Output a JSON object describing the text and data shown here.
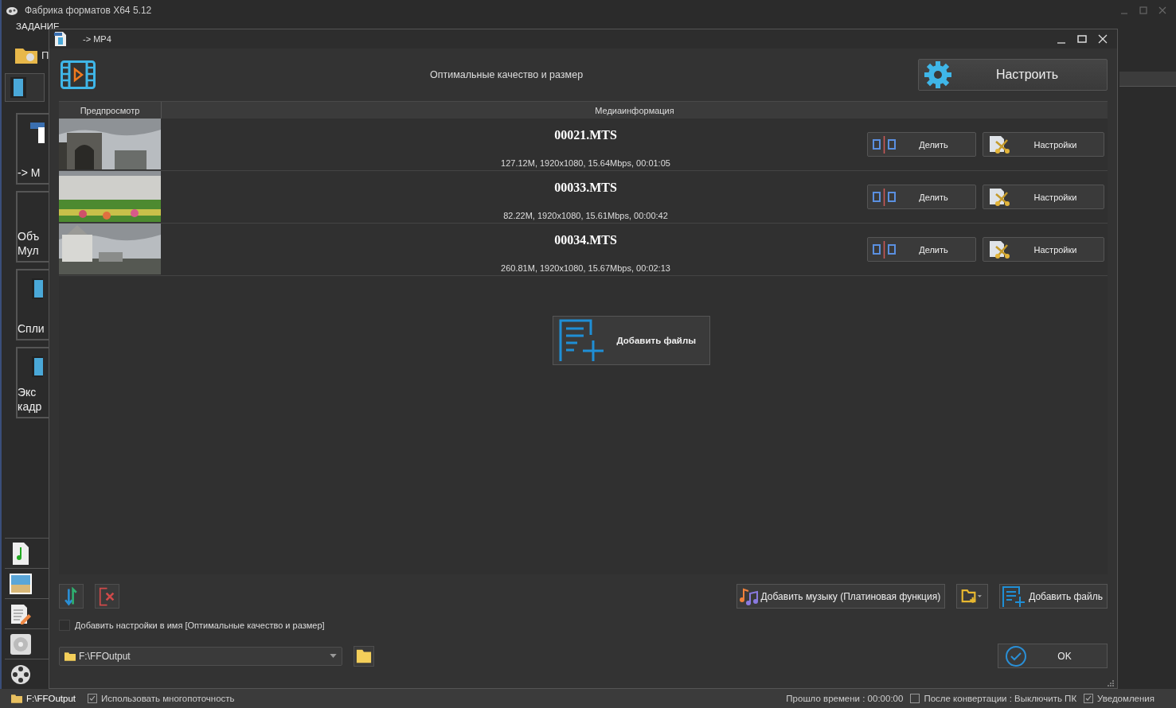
{
  "app": {
    "title": "Фабрика форматов X64 5.12",
    "menu": [
      "ЗАДАНИЕ"
    ],
    "toolbar_label": "П",
    "tasks": [
      {
        "lines": [
          "-> M"
        ]
      },
      {
        "lines": [
          "Объ",
          "Мул"
        ]
      },
      {
        "lines": [
          "Спли"
        ]
      },
      {
        "lines": [
          "Экс",
          "кадр"
        ]
      }
    ]
  },
  "dialog": {
    "title": "-> MP4",
    "profile": "Оптимальные качество и размер",
    "configure_button": "Настроить",
    "table": {
      "columns": [
        "Предпросмотр",
        "Медиаинформация"
      ],
      "rows": [
        {
          "filename": "00021.MTS",
          "info": "127.12M, 1920x1080, 15.64Mbps, 00:01:05",
          "split_button": "Делить",
          "settings_button": "Настройки"
        },
        {
          "filename": "00033.MTS",
          "info": "82.22M, 1920x1080, 15.61Mbps, 00:00:42",
          "split_button": "Делить",
          "settings_button": "Настройки"
        },
        {
          "filename": "00034.MTS",
          "info": "260.81M, 1920x1080, 15.67Mbps, 00:02:13",
          "split_button": "Делить",
          "settings_button": "Настройки"
        }
      ]
    },
    "add_files_center": "Добавить файлы",
    "add_music_button": "Добавить музыку (Платиновая функция)",
    "add_files_button": "Добавить файль",
    "add_settings_to_name": {
      "label": "Добавить настройки в имя [Оптимальные качество и размер]",
      "checked": false
    },
    "output_folder": "F:\\FFOutput",
    "ok_button": "OK"
  },
  "status_bar": {
    "output_path": "F:\\FFOutput",
    "multithreading": {
      "label": "Использовать многопоточность",
      "checked": true
    },
    "elapsed": "Прошло времени : 00:00:00",
    "shutdown": {
      "label": "После конвертации : Выключить ПК",
      "checked": false
    },
    "notifications": {
      "label": "Уведомления",
      "checked": true
    }
  }
}
